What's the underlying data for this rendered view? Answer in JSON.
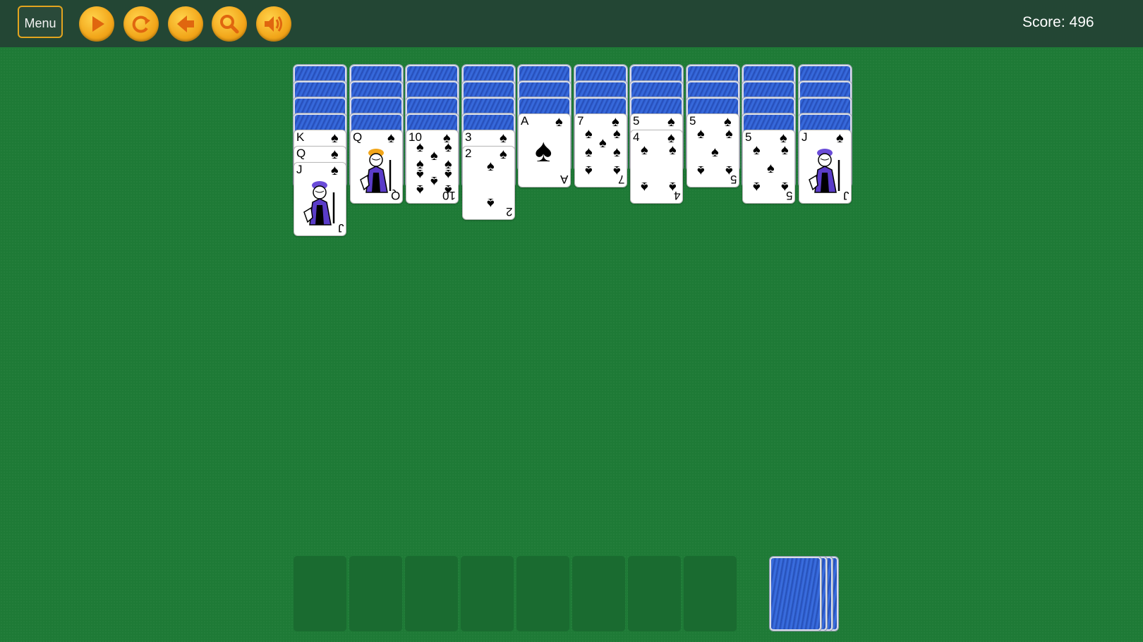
{
  "toolbar": {
    "menu_label": "Menu",
    "buttons": [
      {
        "name": "play-icon"
      },
      {
        "name": "restart-icon"
      },
      {
        "name": "undo-icon"
      },
      {
        "name": "hint-magnifier-icon"
      },
      {
        "name": "sound-icon"
      }
    ]
  },
  "score": {
    "label": "Score:",
    "value": "496"
  },
  "colors": {
    "felt": "#1e7a36",
    "topbar": "#234634",
    "accent": "#f2a61a",
    "card_back": "#2b56c8"
  },
  "tableau": [
    {
      "face_down": 4,
      "face_up": [
        "K♠",
        "Q♠",
        "J♠"
      ]
    },
    {
      "face_down": 4,
      "face_up": [
        "Q♠"
      ]
    },
    {
      "face_down": 4,
      "face_up": [
        "10♠"
      ]
    },
    {
      "face_down": 4,
      "face_up": [
        "3♠",
        "2♠"
      ]
    },
    {
      "face_down": 3,
      "face_up": [
        "A♠"
      ]
    },
    {
      "face_down": 3,
      "face_up": [
        "7♠"
      ]
    },
    {
      "face_down": 3,
      "face_up": [
        "5♠",
        "4♠"
      ]
    },
    {
      "face_down": 3,
      "face_up": [
        "5♠"
      ]
    },
    {
      "face_down": 4,
      "face_up": [
        "5♠"
      ]
    },
    {
      "face_down": 4,
      "face_up": [
        "J♠"
      ]
    }
  ],
  "foundations": {
    "count": 8,
    "filled": 0
  },
  "stock": {
    "piles_remaining": 4
  }
}
